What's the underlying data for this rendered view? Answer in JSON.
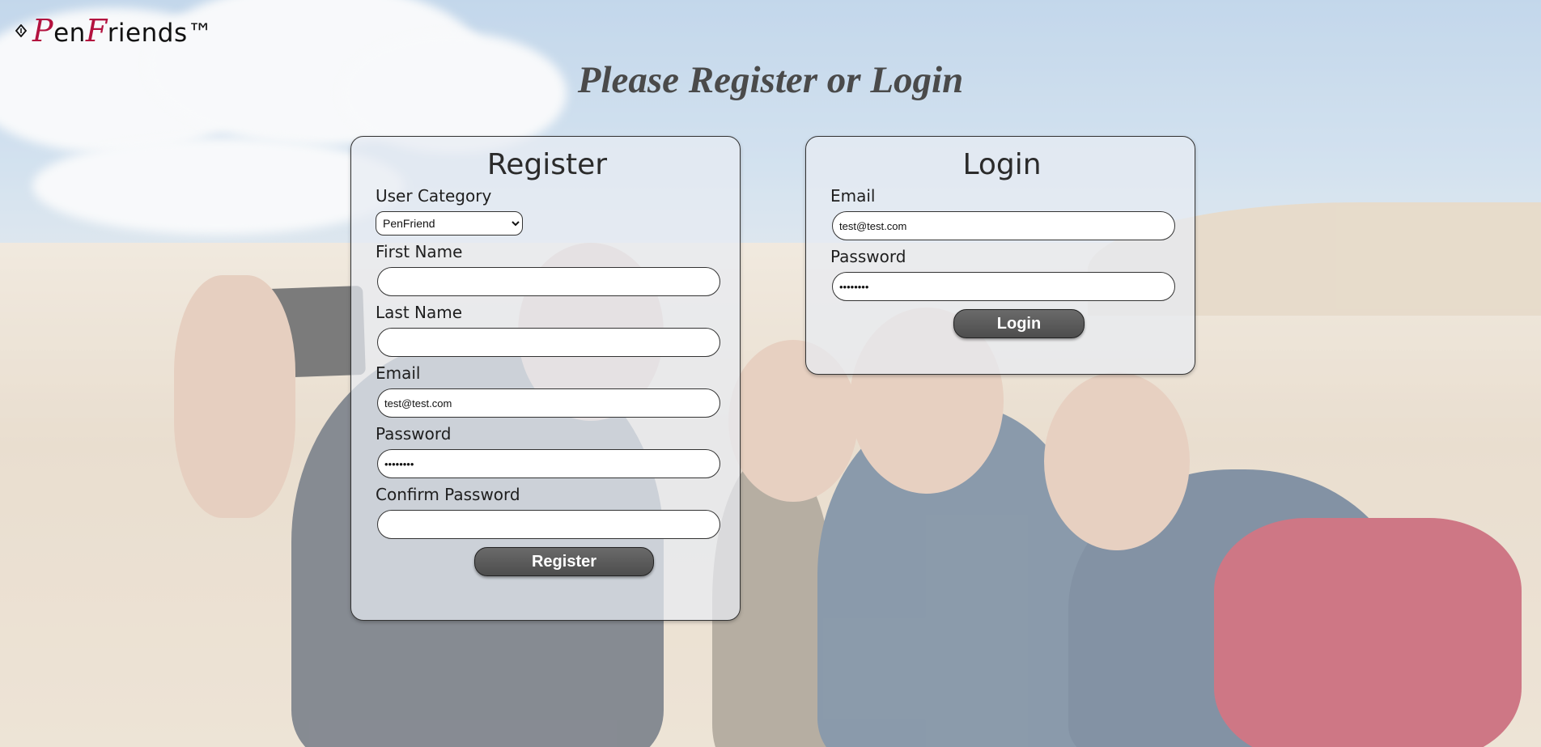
{
  "header": {
    "logo_parts": {
      "p": "P",
      "en": "en",
      "f": "F",
      "riends": "riends™"
    },
    "logo_icon": "pen-nib-icon",
    "page_title": "Please Register or Login"
  },
  "register": {
    "title": "Register",
    "user_category_label": "User Category",
    "user_category_value": "PenFriend",
    "user_category_options": [
      "PenFriend"
    ],
    "first_name_label": "First Name",
    "first_name_value": "",
    "last_name_label": "Last Name",
    "last_name_value": "",
    "email_label": "Email",
    "email_value": "test@test.com",
    "password_label": "Password",
    "password_value": "password",
    "confirm_password_label": "Confirm Password",
    "confirm_password_value": "",
    "submit_label": "Register"
  },
  "login": {
    "title": "Login",
    "email_label": "Email",
    "email_value": "test@test.com",
    "password_label": "Password",
    "password_value": "password",
    "submit_label": "Login"
  },
  "colors": {
    "brand_accent": "#b3123f",
    "button_bg": "#555555",
    "title_text": "#4a4a4a"
  }
}
